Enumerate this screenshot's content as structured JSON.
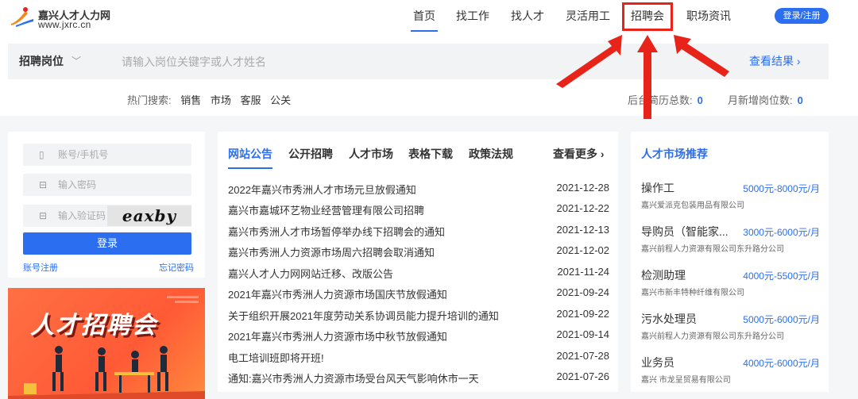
{
  "brand": {
    "name": "嘉兴人才人力网",
    "url": "www.jxrc.cn"
  },
  "nav": {
    "items": [
      "首页",
      "找工作",
      "找人才",
      "灵活用工",
      "招聘会",
      "职场资讯"
    ],
    "login": "登录/注册"
  },
  "search": {
    "category": "招聘岗位",
    "placeholder": "请输入岗位关键字或人才姓名",
    "view": "查看结果"
  },
  "hot": {
    "label": "热门搜索:",
    "keywords": [
      "销售",
      "市场",
      "客服",
      "公关"
    ]
  },
  "stats": {
    "resumes_label": "后台简历总数:",
    "resumes_value": "0",
    "jobs_label": "月新增岗位数:",
    "jobs_value": "0"
  },
  "login": {
    "account_placeholder": "账号/手机号",
    "password_placeholder": "输入密码",
    "captcha_placeholder": "输入验证码",
    "captcha_text": "eaxby",
    "submit": "登录",
    "register": "账号注册",
    "forgot": "忘记密码"
  },
  "banner": {
    "title": "人才招聘会"
  },
  "news": {
    "tabs": [
      "网站公告",
      "公开招聘",
      "人才市场",
      "表格下载",
      "政策法规"
    ],
    "more": "查看更多",
    "items": [
      {
        "title": "2022年嘉兴市秀洲人才市场元旦放假通知",
        "date": "2021-12-28"
      },
      {
        "title": "嘉兴市嘉城环艺物业经营管理有限公司招聘",
        "date": "2021-12-22"
      },
      {
        "title": "嘉兴市秀洲人才市场暂停举办线下招聘会的通知",
        "date": "2021-12-13"
      },
      {
        "title": "嘉兴市秀洲人力资源市场周六招聘会取消通知",
        "date": "2021-12-02"
      },
      {
        "title": "嘉兴人才人力网网站迁移、改版公告",
        "date": "2021-11-24"
      },
      {
        "title": "2021年嘉兴市秀洲人力资源市场国庆节放假通知",
        "date": "2021-09-24"
      },
      {
        "title": "关于组织开展2021年度劳动关系协调员能力提升培训的通知",
        "date": "2021-09-22"
      },
      {
        "title": "2021年嘉兴市秀洲人力资源市场中秋节放假通知",
        "date": "2021-09-14"
      },
      {
        "title": "电工培训班即将开班!",
        "date": "2021-07-28"
      },
      {
        "title": "通知:嘉兴市秀洲人力资源市场受台风天气影响休市一天",
        "date": "2021-07-26"
      }
    ]
  },
  "market": {
    "title": "人才市场推荐",
    "jobs": [
      {
        "title": "操作工",
        "salary": "5000元-8000元/月",
        "company": "嘉兴爱派克包装用品有限公司"
      },
      {
        "title": "导购员（智能家...",
        "salary": "3000元-6000元/月",
        "company": "嘉兴前程人力资源有限公司东升路分公司"
      },
      {
        "title": "检测助理",
        "salary": "4000元-5500元/月",
        "company": "嘉兴市新丰特种纤维有限公司"
      },
      {
        "title": "污水处理员",
        "salary": "5000元-6000元/月",
        "company": "嘉兴前程人力资源有限公司东升路分公司"
      },
      {
        "title": "业务员",
        "salary": "4000元-6000元/月",
        "company": "嘉兴 市龙呈贸易有限公司"
      }
    ]
  },
  "colors": {
    "accent": "#2b6ef0",
    "annotation": "#e8231a",
    "banner": "#ff5a36"
  }
}
